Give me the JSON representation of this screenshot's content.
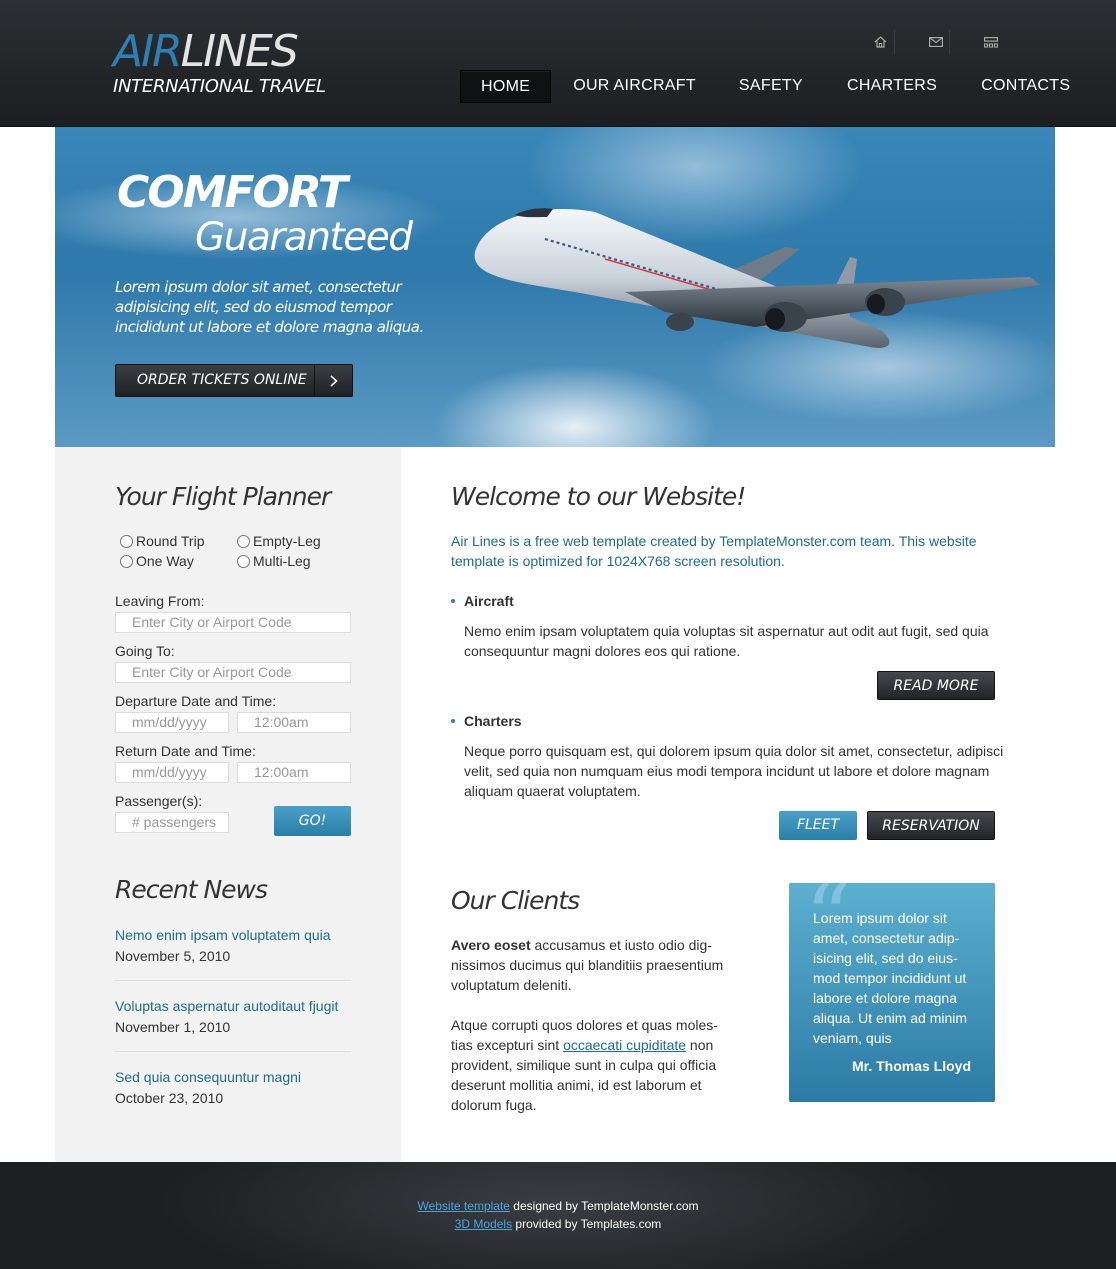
{
  "logo": {
    "air": "AIR",
    "lines": "LINES",
    "subtitle": "INTERNATIONAL TRAVEL"
  },
  "top_icons": [
    "home-icon",
    "mail-icon",
    "sitemap-icon"
  ],
  "nav": [
    {
      "label": "HOME",
      "active": true
    },
    {
      "label": "OUR AIRCRAFT"
    },
    {
      "label": "SAFETY"
    },
    {
      "label": "CHARTERS"
    },
    {
      "label": "CONTACTS"
    }
  ],
  "hero": {
    "title1": "COMFORT",
    "title2": "Guaranteed",
    "text": "Lorem ipsum dolor sit amet, consectetur adipisicing elit, sed do eiusmod tempor incididunt ut labore et dolore magna aliqua.",
    "button_label": "ORDER TICKETS ONLINE"
  },
  "planner": {
    "title": "Your Flight Planner",
    "trip_types": [
      "Round Trip",
      "Empty-Leg",
      "One Way",
      "Multi-Leg"
    ],
    "leaving_label": "Leaving From:",
    "leaving_placeholder": "Enter City or Airport Code",
    "going_label": "Going To:",
    "going_placeholder": "Enter City or Airport Code",
    "departure_label": "Departure Date and Time:",
    "return_label": "Return Date and Time:",
    "date_placeholder": "mm/dd/yyyy",
    "time_placeholder": "12:00am",
    "passengers_label": "Passenger(s):",
    "passengers_placeholder": "# passengers",
    "go_label": "GO!"
  },
  "news": {
    "title": "Recent News",
    "items": [
      {
        "title": "Nemo enim ipsam voluptatem quia",
        "date": "November 5, 2010"
      },
      {
        "title": "Voluptas aspernatur autoditaut fjugit",
        "date": "November 1, 2010"
      },
      {
        "title": "Sed quia consequuntur magni",
        "date": "October 23, 2010"
      }
    ]
  },
  "welcome": {
    "title": "Welcome to our Website!",
    "intro": "Air Lines is a free web template created by TemplateMonster.com team. This website template is optimized for 1024X768 screen resolution.",
    "sections": [
      {
        "heading": "Aircraft",
        "text": "Nemo enim ipsam voluptatem quia voluptas sit aspernatur aut odit aut fugit, sed quia consequuntur magni dolores eos qui ratione."
      },
      {
        "heading": "Charters",
        "text": "Neque porro quisquam est, qui dolorem ipsum quia dolor sit amet, consectetur, adipisci velit, sed quia non numquam eius modi tempora incidunt ut labore et dolore magnam aliquam quaerat voluptatem."
      }
    ],
    "read_more": "READ MORE",
    "fleet": "FLEET",
    "reservation": "RESERVATION"
  },
  "clients": {
    "title": "Our Clients",
    "p1_bold": "Avero eoset",
    "p1_rest": " accusamus et iusto odio dig-nissimos ducimus qui blanditiis praesentium voluptatum deleniti.",
    "p2_before": "Atque corrupti quos dolores et quas moles-tias excepturi sint ",
    "p2_link": "occaecati cupiditate",
    "p2_after": " non provident, similique sunt in culpa qui officia deserunt mollitia animi, id est laborum et dolorum fuga.",
    "quote": "Lorem ipsum dolor sit amet, consectetur adip-isicing elit, sed do eius-mod tempor incididunt ut labore et dolore magna aliqua. Ut enim ad minim veniam, quis",
    "quote_author": "Mr. Thomas Lloyd"
  },
  "footer": {
    "line1_link": "Website template",
    "line1_rest": " designed by TemplateMonster.com",
    "line2_link": "3D Models",
    "line2_rest": " provided by Templates.com"
  },
  "colors": {
    "accent_blue": "#2e7fb3",
    "link_blue": "#216b96",
    "dark": "#1c1e21"
  }
}
